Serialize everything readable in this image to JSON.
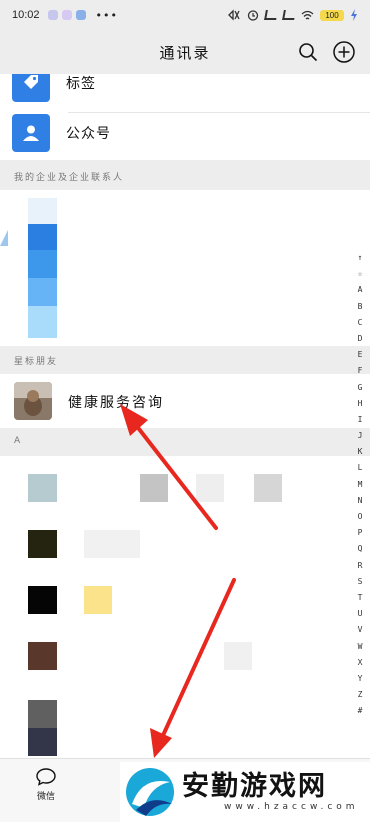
{
  "status_bar": {
    "time": "10:02",
    "more": "•••",
    "battery": "100"
  },
  "nav": {
    "title": "通讯录"
  },
  "entries": [
    {
      "label": "标签",
      "icon": "tag-icon"
    },
    {
      "label": "公众号",
      "icon": "official-account-icon"
    }
  ],
  "sections": {
    "enterprise": "我的企业及企业联系人",
    "starred": "星标朋友",
    "letter_a": "A"
  },
  "starred_contact": {
    "name": "健康服务咨询"
  },
  "index_letters": [
    "↑",
    "☆",
    "A",
    "B",
    "C",
    "D",
    "E",
    "F",
    "G",
    "H",
    "I",
    "J",
    "K",
    "L",
    "M",
    "N",
    "O",
    "P",
    "Q",
    "R",
    "S",
    "T",
    "U",
    "V",
    "W",
    "X",
    "Y",
    "Z",
    "#"
  ],
  "tab_bar": {
    "wechat_label": "微信"
  },
  "watermark": {
    "main": "安勤游戏网",
    "sub": "www.hzaccw.com"
  },
  "colors": {
    "accent_blue": "#2f7fe4",
    "arrow_red": "#e8281f"
  }
}
